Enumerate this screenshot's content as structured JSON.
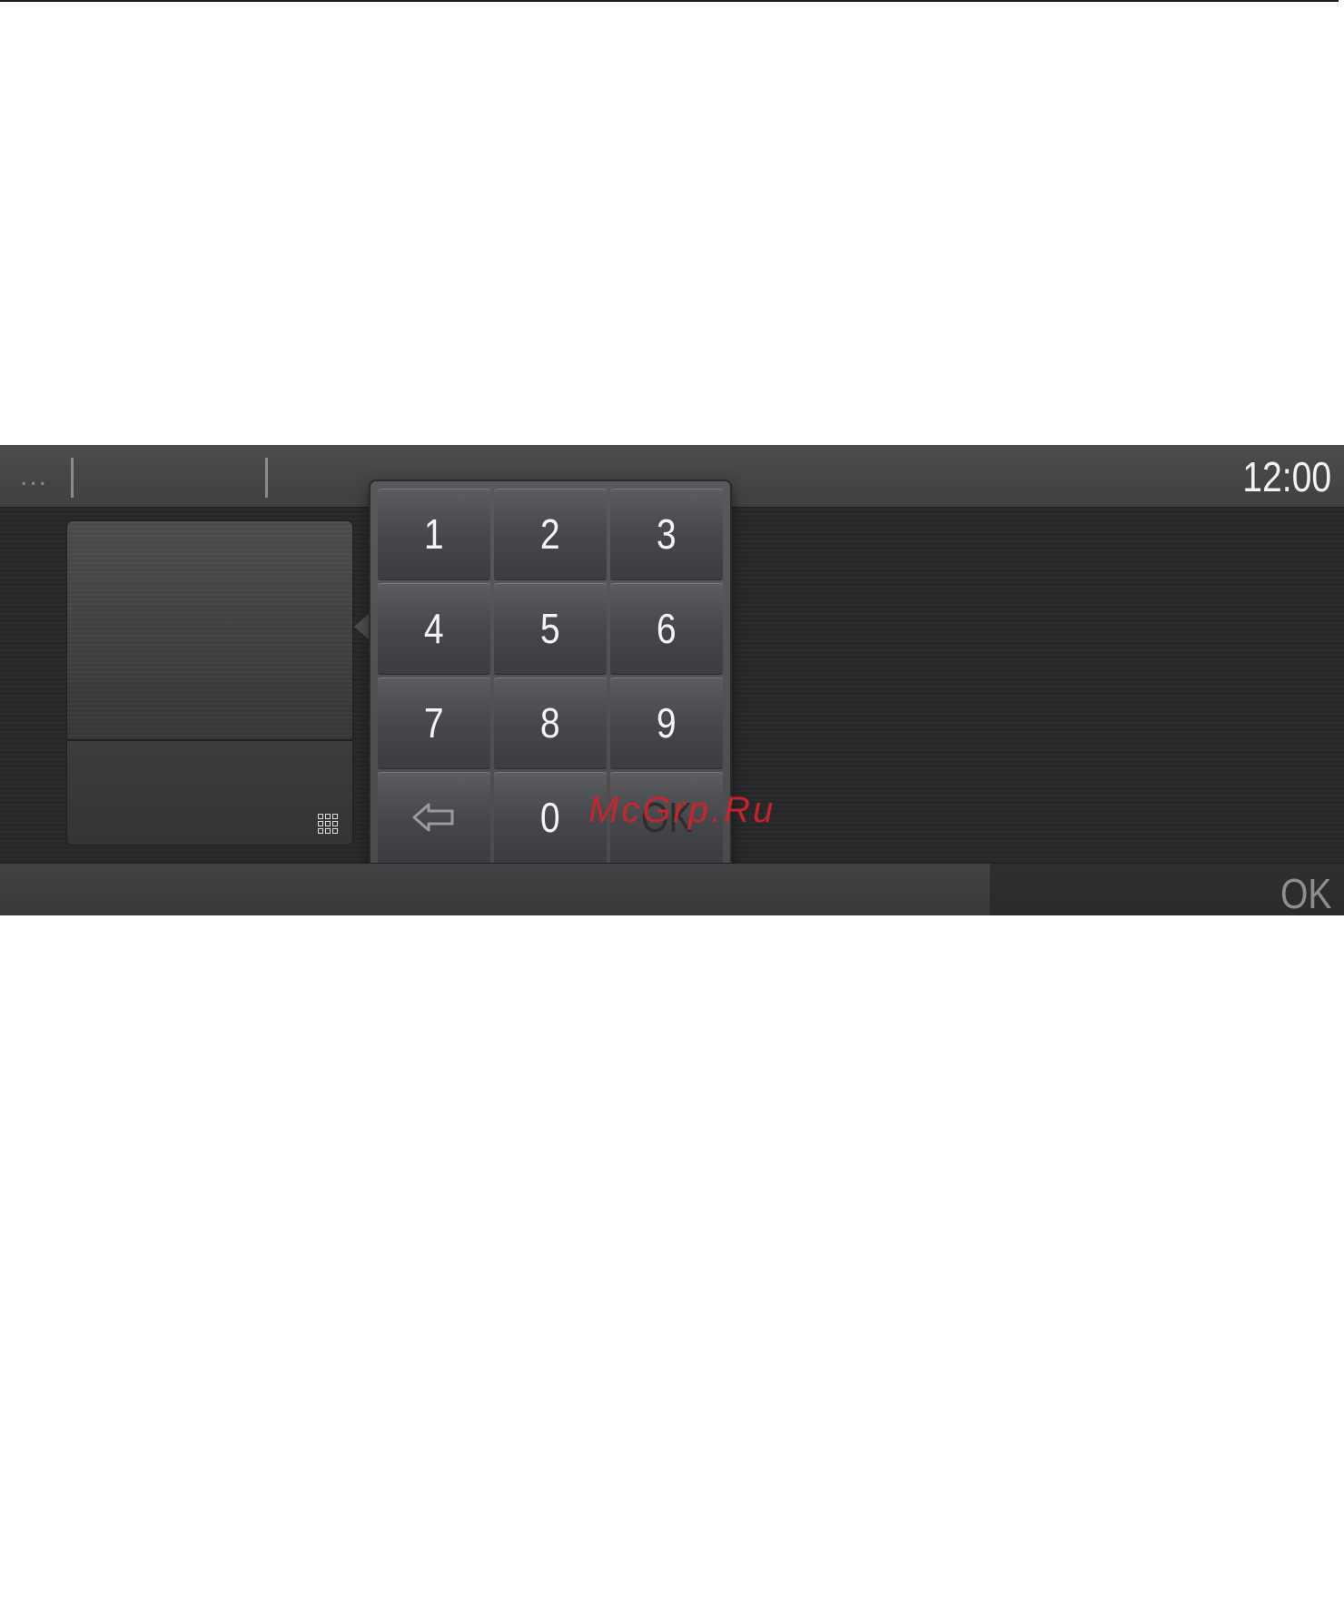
{
  "status_bar": {
    "ellipsis": "...",
    "clock": "12:00"
  },
  "keypad": {
    "keys": [
      "1",
      "2",
      "3",
      "4",
      "5",
      "6",
      "7",
      "8",
      "9",
      "0"
    ],
    "backspace_icon": "backspace-arrow-icon",
    "ok_label": "OK"
  },
  "left_panel": {
    "icon": "keypad-grid-icon"
  },
  "bottom_bar": {
    "ok_label": "OK"
  },
  "watermark": "McGrp.Ru"
}
